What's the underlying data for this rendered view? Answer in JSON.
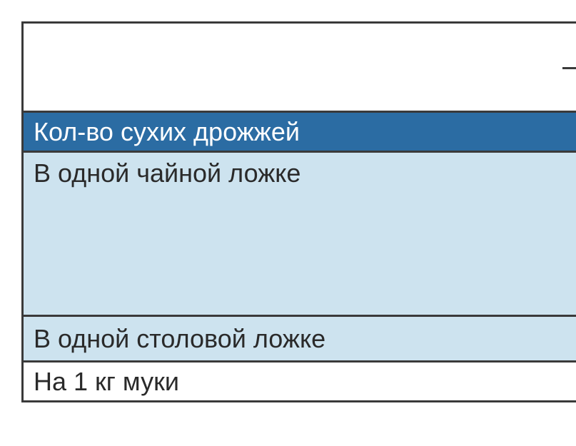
{
  "table": {
    "header": "Кол-во сухих дрожжей",
    "rows": [
      "В одной чайной ложке",
      "В одной столовой ложке",
      "На 1 кг муки"
    ]
  }
}
